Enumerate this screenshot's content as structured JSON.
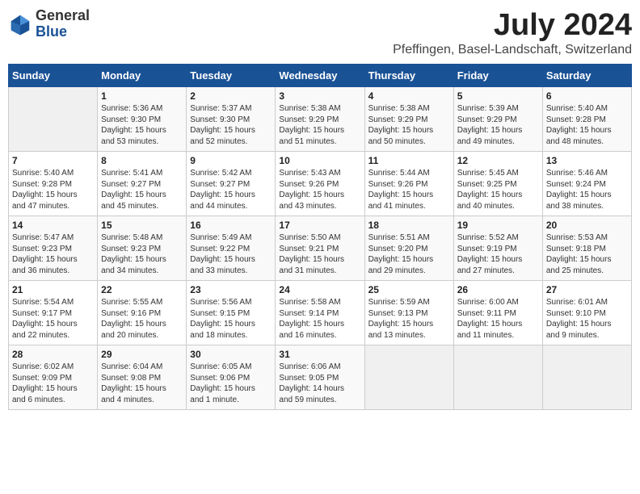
{
  "logo": {
    "general": "General",
    "blue": "Blue"
  },
  "title": "July 2024",
  "subtitle": "Pfeffingen, Basel-Landschaft, Switzerland",
  "headers": [
    "Sunday",
    "Monday",
    "Tuesday",
    "Wednesday",
    "Thursday",
    "Friday",
    "Saturday"
  ],
  "weeks": [
    [
      {
        "day": "",
        "info": ""
      },
      {
        "day": "1",
        "info": "Sunrise: 5:36 AM\nSunset: 9:30 PM\nDaylight: 15 hours\nand 53 minutes."
      },
      {
        "day": "2",
        "info": "Sunrise: 5:37 AM\nSunset: 9:30 PM\nDaylight: 15 hours\nand 52 minutes."
      },
      {
        "day": "3",
        "info": "Sunrise: 5:38 AM\nSunset: 9:29 PM\nDaylight: 15 hours\nand 51 minutes."
      },
      {
        "day": "4",
        "info": "Sunrise: 5:38 AM\nSunset: 9:29 PM\nDaylight: 15 hours\nand 50 minutes."
      },
      {
        "day": "5",
        "info": "Sunrise: 5:39 AM\nSunset: 9:29 PM\nDaylight: 15 hours\nand 49 minutes."
      },
      {
        "day": "6",
        "info": "Sunrise: 5:40 AM\nSunset: 9:28 PM\nDaylight: 15 hours\nand 48 minutes."
      }
    ],
    [
      {
        "day": "7",
        "info": "Sunrise: 5:40 AM\nSunset: 9:28 PM\nDaylight: 15 hours\nand 47 minutes."
      },
      {
        "day": "8",
        "info": "Sunrise: 5:41 AM\nSunset: 9:27 PM\nDaylight: 15 hours\nand 45 minutes."
      },
      {
        "day": "9",
        "info": "Sunrise: 5:42 AM\nSunset: 9:27 PM\nDaylight: 15 hours\nand 44 minutes."
      },
      {
        "day": "10",
        "info": "Sunrise: 5:43 AM\nSunset: 9:26 PM\nDaylight: 15 hours\nand 43 minutes."
      },
      {
        "day": "11",
        "info": "Sunrise: 5:44 AM\nSunset: 9:26 PM\nDaylight: 15 hours\nand 41 minutes."
      },
      {
        "day": "12",
        "info": "Sunrise: 5:45 AM\nSunset: 9:25 PM\nDaylight: 15 hours\nand 40 minutes."
      },
      {
        "day": "13",
        "info": "Sunrise: 5:46 AM\nSunset: 9:24 PM\nDaylight: 15 hours\nand 38 minutes."
      }
    ],
    [
      {
        "day": "14",
        "info": "Sunrise: 5:47 AM\nSunset: 9:23 PM\nDaylight: 15 hours\nand 36 minutes."
      },
      {
        "day": "15",
        "info": "Sunrise: 5:48 AM\nSunset: 9:23 PM\nDaylight: 15 hours\nand 34 minutes."
      },
      {
        "day": "16",
        "info": "Sunrise: 5:49 AM\nSunset: 9:22 PM\nDaylight: 15 hours\nand 33 minutes."
      },
      {
        "day": "17",
        "info": "Sunrise: 5:50 AM\nSunset: 9:21 PM\nDaylight: 15 hours\nand 31 minutes."
      },
      {
        "day": "18",
        "info": "Sunrise: 5:51 AM\nSunset: 9:20 PM\nDaylight: 15 hours\nand 29 minutes."
      },
      {
        "day": "19",
        "info": "Sunrise: 5:52 AM\nSunset: 9:19 PM\nDaylight: 15 hours\nand 27 minutes."
      },
      {
        "day": "20",
        "info": "Sunrise: 5:53 AM\nSunset: 9:18 PM\nDaylight: 15 hours\nand 25 minutes."
      }
    ],
    [
      {
        "day": "21",
        "info": "Sunrise: 5:54 AM\nSunset: 9:17 PM\nDaylight: 15 hours\nand 22 minutes."
      },
      {
        "day": "22",
        "info": "Sunrise: 5:55 AM\nSunset: 9:16 PM\nDaylight: 15 hours\nand 20 minutes."
      },
      {
        "day": "23",
        "info": "Sunrise: 5:56 AM\nSunset: 9:15 PM\nDaylight: 15 hours\nand 18 minutes."
      },
      {
        "day": "24",
        "info": "Sunrise: 5:58 AM\nSunset: 9:14 PM\nDaylight: 15 hours\nand 16 minutes."
      },
      {
        "day": "25",
        "info": "Sunrise: 5:59 AM\nSunset: 9:13 PM\nDaylight: 15 hours\nand 13 minutes."
      },
      {
        "day": "26",
        "info": "Sunrise: 6:00 AM\nSunset: 9:11 PM\nDaylight: 15 hours\nand 11 minutes."
      },
      {
        "day": "27",
        "info": "Sunrise: 6:01 AM\nSunset: 9:10 PM\nDaylight: 15 hours\nand 9 minutes."
      }
    ],
    [
      {
        "day": "28",
        "info": "Sunrise: 6:02 AM\nSunset: 9:09 PM\nDaylight: 15 hours\nand 6 minutes."
      },
      {
        "day": "29",
        "info": "Sunrise: 6:04 AM\nSunset: 9:08 PM\nDaylight: 15 hours\nand 4 minutes."
      },
      {
        "day": "30",
        "info": "Sunrise: 6:05 AM\nSunset: 9:06 PM\nDaylight: 15 hours\nand 1 minute."
      },
      {
        "day": "31",
        "info": "Sunrise: 6:06 AM\nSunset: 9:05 PM\nDaylight: 14 hours\nand 59 minutes."
      },
      {
        "day": "",
        "info": ""
      },
      {
        "day": "",
        "info": ""
      },
      {
        "day": "",
        "info": ""
      }
    ]
  ]
}
